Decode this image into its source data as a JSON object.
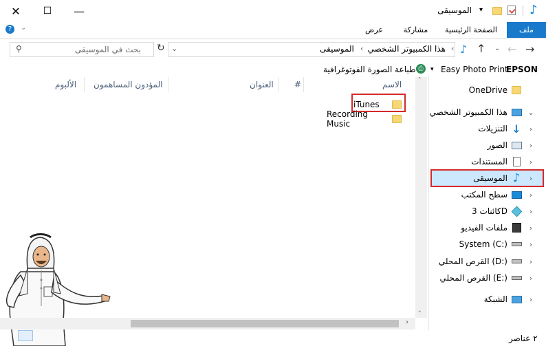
{
  "window": {
    "title": "الموسيقى",
    "controls": {
      "close": "✕",
      "maximize": "☐",
      "minimize": "—"
    }
  },
  "ribbon": {
    "tabs": [
      {
        "label": "ملف",
        "active": true
      },
      {
        "label": "الصفحة الرئيسية",
        "active": false
      },
      {
        "label": "مشاركة",
        "active": false
      },
      {
        "label": "عرض",
        "active": false
      }
    ]
  },
  "address": {
    "path": [
      "هذا الكمبيوتر الشخصي",
      "الموسيقى"
    ],
    "search_placeholder": "بحث في الموسيقى"
  },
  "toolbar2": {
    "brand": "EPSON",
    "photo_print": "Easy Photo Print",
    "print_photo": "طباعة الصورة الفوتوغرافية"
  },
  "columns": [
    "الاسم",
    "#",
    "العنوان",
    "المؤدون المساهمون",
    "الألبوم"
  ],
  "files": [
    {
      "name": "iTunes",
      "highlighted": true
    },
    {
      "name": "Recording Music",
      "highlighted": false
    }
  ],
  "nav": {
    "items": [
      {
        "label": "OneDrive",
        "icon": "folder-icon",
        "chevron": ""
      },
      {
        "label": "هذا الكمبيوتر الشخصي",
        "icon": "computer-icon",
        "chevron": "⌄"
      },
      {
        "label": "التنزيلات",
        "icon": "download-arrow-icon",
        "chevron": "›"
      },
      {
        "label": "الصور",
        "icon": "pictures-icon",
        "chevron": "›"
      },
      {
        "label": "المستندات",
        "icon": "documents-icon",
        "chevron": "›"
      },
      {
        "label": "الموسيقى",
        "icon": "music-note-icon",
        "chevron": "›",
        "selected": true
      },
      {
        "label": "سطح المكتب",
        "icon": "desktop-icon",
        "chevron": "›"
      },
      {
        "label": "كائنات 3D",
        "icon": "cube-3d-icon",
        "chevron": "›"
      },
      {
        "label": "ملفات الفيديو",
        "icon": "video-film-icon",
        "chevron": "›"
      },
      {
        "label": "System (C:)",
        "icon": "drive-icon",
        "chevron": "›"
      },
      {
        "label": "القرص المحلي (D:)",
        "icon": "drive-icon",
        "chevron": "›"
      },
      {
        "label": "القرص المحلي (E:)",
        "icon": "drive-icon",
        "chevron": "›"
      },
      {
        "label": "الشبكة",
        "icon": "network-icon",
        "chevron": "›"
      }
    ]
  },
  "status": {
    "count": "٢ عناصر"
  },
  "colors": {
    "accent": "#1979ca",
    "highlight": "#d42a2a",
    "selected_bg": "#cce8ff"
  }
}
